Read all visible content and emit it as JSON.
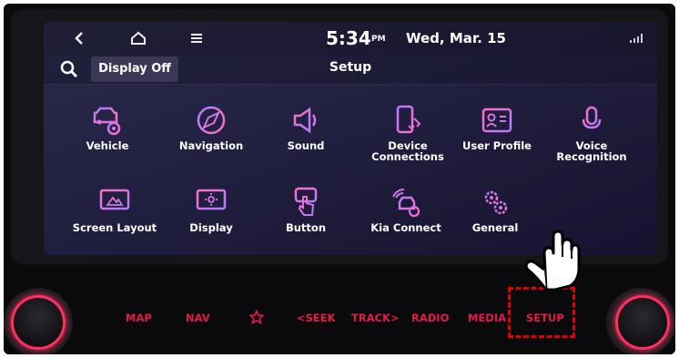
{
  "statusbar": {
    "back_icon": "chevron-left-icon",
    "home_icon": "home-icon",
    "menu_icon": "menu-icon",
    "time": "5:34",
    "ampm": "PM",
    "date": "Wed, Mar. 15"
  },
  "titlebar": {
    "display_off": "Display Off",
    "title": "Setup"
  },
  "tiles": [
    {
      "label": "Vehicle",
      "icon": "vehicle-settings-icon"
    },
    {
      "label": "Navigation",
      "icon": "compass-icon"
    },
    {
      "label": "Sound",
      "icon": "speaker-icon"
    },
    {
      "label": "Device\nConnections",
      "icon": "phone-connection-icon"
    },
    {
      "label": "User Profile",
      "icon": "user-profile-icon"
    },
    {
      "label": "Voice\nRecognition",
      "icon": "microphone-icon"
    },
    {
      "label": "Screen Layout",
      "icon": "screen-layout-icon"
    },
    {
      "label": "Display",
      "icon": "display-brightness-icon"
    },
    {
      "label": "Button",
      "icon": "button-press-icon"
    },
    {
      "label": "Kia Connect",
      "icon": "kia-connect-icon"
    },
    {
      "label": "General",
      "icon": "gears-icon"
    }
  ],
  "panel": {
    "map": "MAP",
    "nav": "NAV",
    "favorite_icon": "star-icon",
    "seek": "<SEEK",
    "track": "TRACK>",
    "radio": "RADIO",
    "media": "MEDIA",
    "setup": "SETUP"
  },
  "colors": {
    "accent": "#e31b4a",
    "icon_pink": "#f06fd0",
    "icon_purple": "#b07cff",
    "highlight": "#e00000"
  }
}
